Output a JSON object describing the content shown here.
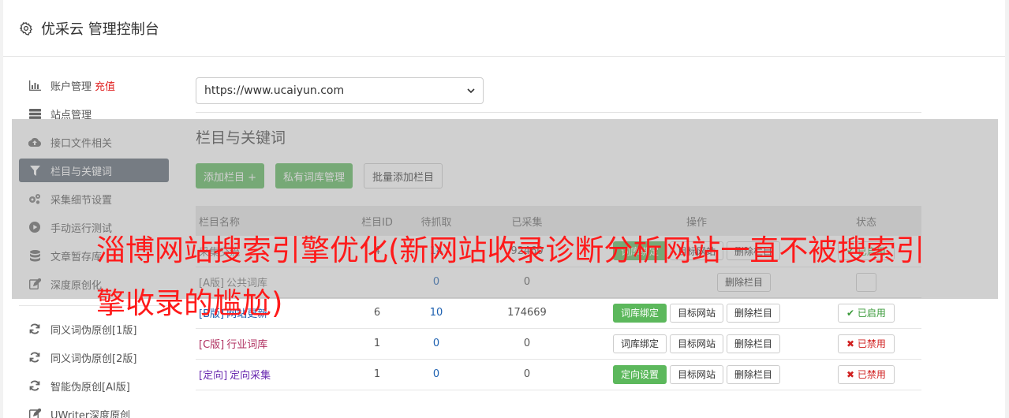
{
  "header": {
    "title": "优采云 管理控制台"
  },
  "sidebar": {
    "items": [
      {
        "label": "账户管理",
        "extra": "充值",
        "icon": "bar-chart-icon"
      },
      {
        "label": "站点管理",
        "icon": "server-icon"
      },
      {
        "label": "接口文件相关",
        "icon": "cloud-upload-icon"
      },
      {
        "label": "栏目与关键词",
        "icon": "filter-icon",
        "active": true
      },
      {
        "label": "采集细节设置",
        "icon": "cogs-icon"
      },
      {
        "label": "手动运行测试",
        "icon": "play-circle-icon"
      },
      {
        "label": "文章暂存库",
        "icon": "database-icon"
      },
      {
        "label": "深度原创化",
        "icon": "edit-icon"
      }
    ],
    "items2": [
      {
        "label": "同义词伪原创[1版]",
        "icon": "refresh-icon"
      },
      {
        "label": "同义词伪原创[2版]",
        "icon": "refresh-icon"
      },
      {
        "label": "智能伪原创[AI版]",
        "icon": "refresh-icon"
      },
      {
        "label": "UWriter深度原创",
        "icon": "edit-icon"
      }
    ]
  },
  "main": {
    "site_select": "https://www.ucaiyun.com",
    "section_title": "栏目与关键词",
    "buttons": {
      "add": "添加栏目 +",
      "private_lib": "私有词库管理",
      "batch_add": "批量添加栏目"
    },
    "table": {
      "headers": [
        "栏目名称",
        "栏目ID",
        "待抓取",
        "已采集",
        "操作",
        "状态"
      ],
      "rows": [
        {
          "tag": "",
          "name": "采集交流",
          "id": "4",
          "pending": "14",
          "collected": "92460",
          "op1": "词库绑定",
          "op2": "目标网站",
          "op3": "删除栏目",
          "status": "已启用"
        },
        {
          "tag": "[A版]",
          "name": "公共词库",
          "id": "",
          "pending": "0",
          "collected": "0",
          "op1": "",
          "op2": "",
          "op3": "删除栏目",
          "status": ""
        },
        {
          "tag": "[B版]",
          "name": "网站更新",
          "id": "6",
          "pending": "10",
          "collected": "174669",
          "op1": "词库绑定",
          "op2": "目标网站",
          "op3": "删除栏目",
          "status": "已启用"
        },
        {
          "tag": "[C版]",
          "name": "行业词库",
          "id": "1",
          "pending": "0",
          "collected": "0",
          "op1": "词库绑定",
          "op2": "目标网站",
          "op3": "删除栏目",
          "status": "已禁用"
        },
        {
          "tag": "[定向]",
          "name": "定向采集",
          "id": "1",
          "pending": "0",
          "collected": "0",
          "op1": "定向设置",
          "op2": "目标网站",
          "op3": "删除栏目",
          "status": "已禁用"
        }
      ]
    }
  },
  "overlay": {
    "text": "淄博网站搜索引擎优化(新网站收录诊断分析网站一直不被搜索引擎收录的尴尬)"
  },
  "colors": {
    "accent_green": "#5cb85c",
    "active_nav": "#5b6673",
    "overlay_red": "#ff1a1a"
  }
}
